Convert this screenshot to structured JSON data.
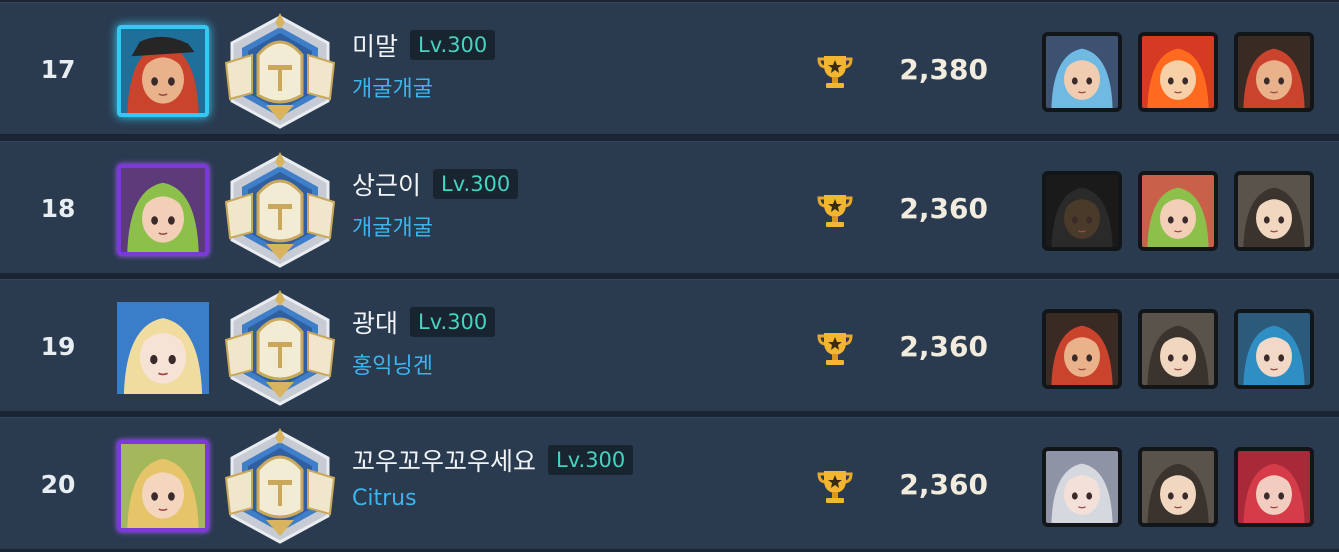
{
  "ranking": [
    {
      "rank": "17",
      "name": "미말",
      "level": "Lv.300",
      "guild": "개굴개굴",
      "score": "2,380",
      "frame": "ice",
      "avatar": {
        "hair": "#c9432d",
        "skin": "#e9b28b",
        "bg": "#1f6f9b",
        "hat": "#262626"
      },
      "team": [
        {
          "hair": "#6fb9e2",
          "skin": "#f0cdb1",
          "bg": "#3d5270"
        },
        {
          "hair": "#ff6a1f",
          "skin": "#f7d0a8",
          "bg": "#d63a22"
        },
        {
          "hair": "#c9432d",
          "skin": "#e9b28b",
          "bg": "#3a2a24"
        }
      ]
    },
    {
      "rank": "18",
      "name": "상근이",
      "level": "Lv.300",
      "guild": "개굴개굴",
      "score": "2,360",
      "frame": "purple",
      "avatar": {
        "hair": "#8cc04b",
        "skin": "#f3cfb8",
        "bg": "#5d3b7a",
        "hat": ""
      },
      "team": [
        {
          "hair": "#2a2a2a",
          "skin": "#4a3a2a",
          "bg": "#1a1a1a"
        },
        {
          "hair": "#8cc04b",
          "skin": "#f3cfb8",
          "bg": "#c8604a"
        },
        {
          "hair": "#3a332e",
          "skin": "#f1d6c0",
          "bg": "#5a534c"
        }
      ]
    },
    {
      "rank": "19",
      "name": "광대",
      "level": "Lv.300",
      "guild": "홍익닝겐",
      "score": "2,360",
      "frame": "none",
      "avatar": {
        "hair": "#f1dca0",
        "skin": "#f6e3d6",
        "bg": "#3a7dc9",
        "hat": ""
      },
      "team": [
        {
          "hair": "#c9432d",
          "skin": "#e9b28b",
          "bg": "#3a2a24"
        },
        {
          "hair": "#3a332e",
          "skin": "#f1d6c0",
          "bg": "#5a534c"
        },
        {
          "hair": "#2f8fc4",
          "skin": "#f2d8c6",
          "bg": "#2b5a7a"
        }
      ]
    },
    {
      "rank": "20",
      "name": "꼬우꼬우꼬우세요",
      "level": "Lv.300",
      "guild": "Citrus",
      "score": "2,360",
      "frame": "purple",
      "avatar": {
        "hair": "#e6c46a",
        "skin": "#f4d6bf",
        "bg": "#a2b85a",
        "hat": ""
      },
      "team": [
        {
          "hair": "#d6d8e0",
          "skin": "#f3e0d8",
          "bg": "#8e93a6"
        },
        {
          "hair": "#3a332e",
          "skin": "#f1d6c0",
          "bg": "#5a534c"
        },
        {
          "hair": "#d63b4a",
          "skin": "#f2cdbf",
          "bg": "#a82a38"
        }
      ]
    }
  ],
  "icons": {
    "emblem": "knight-helmet-emblem-icon",
    "trophy": "trophy-icon"
  }
}
